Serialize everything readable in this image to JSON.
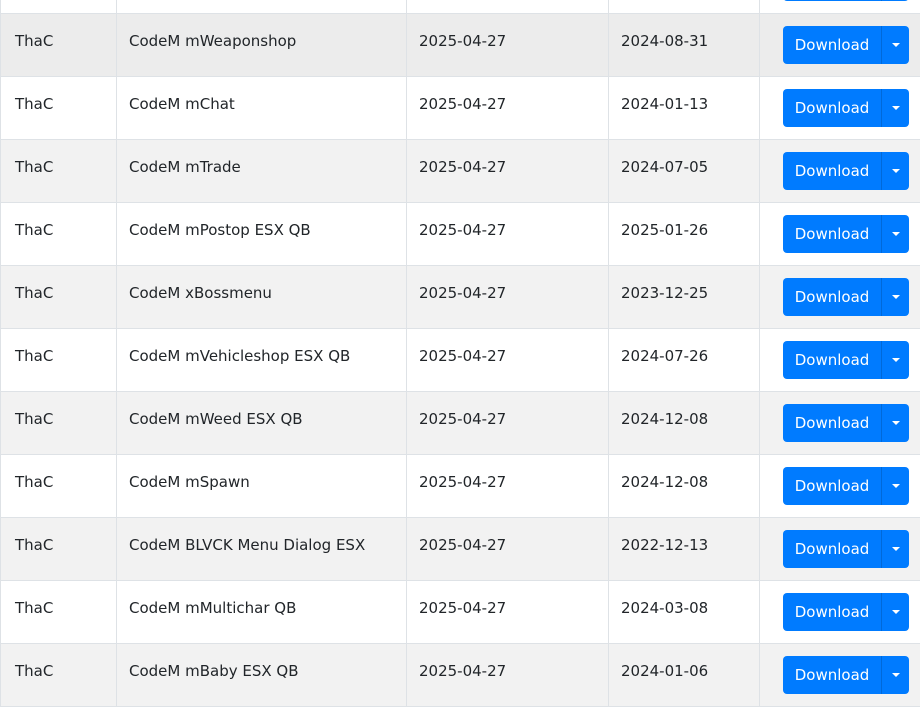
{
  "rows": [
    {
      "author": "",
      "name": "",
      "updated": "",
      "released": "",
      "download_label": "Download"
    },
    {
      "author": "ThaC",
      "name": "CodeM mWeaponshop",
      "updated": "2025-04-27",
      "released": "2024-08-31",
      "download_label": "Download"
    },
    {
      "author": "ThaC",
      "name": "CodeM mChat",
      "updated": "2025-04-27",
      "released": "2024-01-13",
      "download_label": "Download"
    },
    {
      "author": "ThaC",
      "name": "CodeM mTrade",
      "updated": "2025-04-27",
      "released": "2024-07-05",
      "download_label": "Download"
    },
    {
      "author": "ThaC",
      "name": "CodeM mPostop ESX QB",
      "updated": "2025-04-27",
      "released": "2025-01-26",
      "download_label": "Download"
    },
    {
      "author": "ThaC",
      "name": "CodeM xBossmenu",
      "updated": "2025-04-27",
      "released": "2023-12-25",
      "download_label": "Download"
    },
    {
      "author": "ThaC",
      "name": "CodeM mVehicleshop ESX QB",
      "updated": "2025-04-27",
      "released": "2024-07-26",
      "download_label": "Download"
    },
    {
      "author": "ThaC",
      "name": "CodeM mWeed ESX QB",
      "updated": "2025-04-27",
      "released": "2024-12-08",
      "download_label": "Download"
    },
    {
      "author": "ThaC",
      "name": "CodeM mSpawn",
      "updated": "2025-04-27",
      "released": "2024-12-08",
      "download_label": "Download"
    },
    {
      "author": "ThaC",
      "name": "CodeM BLVCK Menu Dialog ESX",
      "updated": "2025-04-27",
      "released": "2022-12-13",
      "download_label": "Download"
    },
    {
      "author": "ThaC",
      "name": "CodeM mMultichar QB",
      "updated": "2025-04-27",
      "released": "2024-03-08",
      "download_label": "Download"
    },
    {
      "author": "ThaC",
      "name": "CodeM mBaby ESX QB",
      "updated": "2025-04-27",
      "released": "2024-01-06",
      "download_label": "Download"
    }
  ],
  "colors": {
    "button": "#007bff",
    "row_stripe": "#f2f2f2",
    "border": "#dee2e6"
  },
  "icons": {
    "dropdown_toggle": "caret-down-icon"
  }
}
